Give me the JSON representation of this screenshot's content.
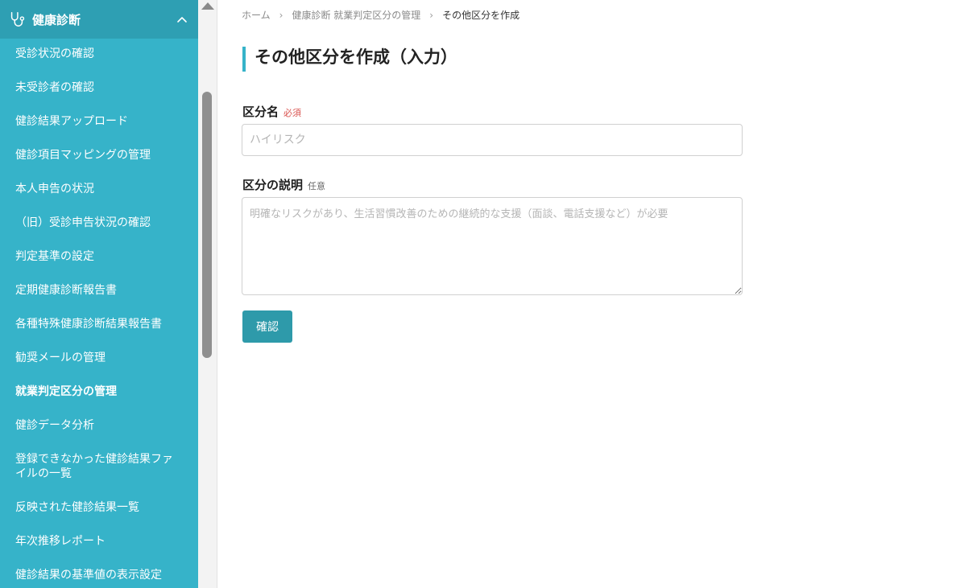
{
  "sidebar": {
    "section_title": "健康診断",
    "items": [
      {
        "label": "受診状況の確認"
      },
      {
        "label": "未受診者の確認"
      },
      {
        "label": "健診結果アップロード"
      },
      {
        "label": "健診項目マッピングの管理"
      },
      {
        "label": "本人申告の状況"
      },
      {
        "label": "（旧）受診申告状況の確認"
      },
      {
        "label": "判定基準の設定"
      },
      {
        "label": "定期健康診断報告書"
      },
      {
        "label": "各種特殊健康診断結果報告書"
      },
      {
        "label": "勧奨メールの管理"
      },
      {
        "label": "就業判定区分の管理",
        "active": true
      },
      {
        "label": "健診データ分析"
      },
      {
        "label": "登録できなかった健診結果ファイルの一覧"
      },
      {
        "label": "反映された健診結果一覧"
      },
      {
        "label": "年次推移レポート"
      },
      {
        "label": "健診結果の基準値の表示設定"
      }
    ]
  },
  "breadcrumb": {
    "home": "ホーム",
    "parent": "健康診断 就業判定区分の管理",
    "current": "その他区分を作成"
  },
  "page_title": "その他区分を作成（入力）",
  "form": {
    "name_label": "区分名",
    "name_required": "必須",
    "name_placeholder": "ハイリスク",
    "name_value": "",
    "desc_label": "区分の説明",
    "desc_optional": "任意",
    "desc_placeholder": "明確なリスクがあり、生活習慣改善のための継続的な支援（面談、電話支援など）が必要",
    "desc_value": "",
    "submit_label": "確認"
  },
  "colors": {
    "sidebar_bg": "#36b3c9",
    "sidebar_header_bg": "#2e9fb3",
    "accent": "#36b3c9",
    "button_bg": "#2e9aaa",
    "required": "#d9534f"
  },
  "icons": {
    "section": "stethoscope-icon",
    "collapse": "chevron-up-icon",
    "breadcrumb_separator": "chevron-right-icon"
  }
}
